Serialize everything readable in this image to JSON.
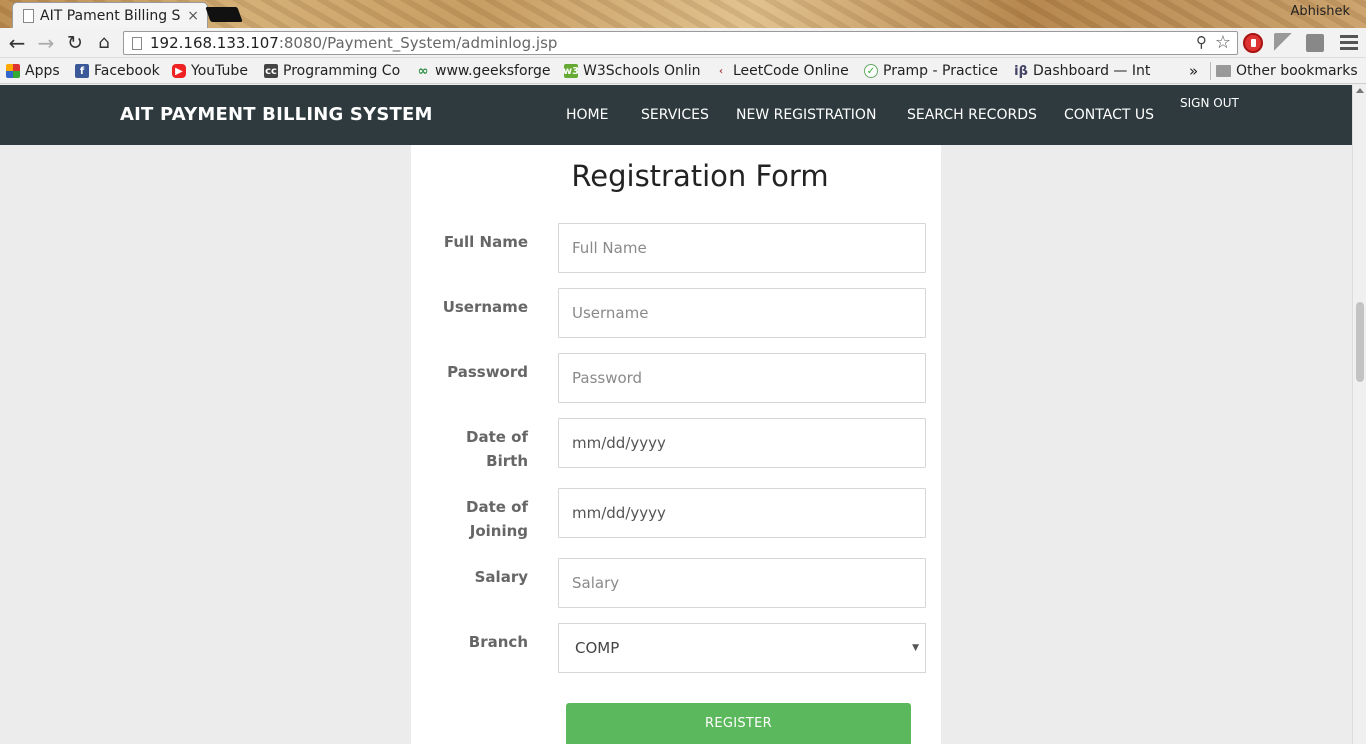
{
  "browser": {
    "tab_title": "AIT Pament Billing S",
    "tab_close": "×",
    "profile_name": "Abhishek",
    "url_host": "192.168.133.107",
    "url_path": ":8080/Payment_System/adminlog.jsp",
    "bookmarks": [
      {
        "label": "Apps",
        "icon": "apps-grid-icon"
      },
      {
        "label": "Facebook",
        "icon": "facebook-icon"
      },
      {
        "label": "YouTube",
        "icon": "youtube-icon"
      },
      {
        "label": "Programming Co",
        "icon": "codechef-icon"
      },
      {
        "label": "www.geeksforge",
        "icon": "geeksforgeeks-icon"
      },
      {
        "label": "W3Schools Onlin",
        "icon": "w3schools-icon"
      },
      {
        "label": "LeetCode Online",
        "icon": "leetcode-icon"
      },
      {
        "label": "Pramp - Practice",
        "icon": "pramp-icon"
      },
      {
        "label": "Dashboard — Int",
        "icon": "interviewbit-icon"
      }
    ],
    "more_bookmarks": "»",
    "other_bookmarks": "Other bookmarks"
  },
  "site": {
    "brand": "AIT PAYMENT BILLING SYSTEM",
    "nav": {
      "home": "HOME",
      "services": "SERVICES",
      "new_registration": "NEW REGISTRATION",
      "search_records": "SEARCH RECORDS",
      "contact_us": "CONTACT US",
      "sign_out": "SIGN OUT"
    },
    "colors": {
      "navbar": "#2f3a3e",
      "register_button": "#5cb85c",
      "page_background": "#ececec"
    }
  },
  "form": {
    "title": "Registration Form",
    "fields": {
      "full_name": {
        "label": "Full Name",
        "placeholder": "Full Name"
      },
      "username": {
        "label": "Username",
        "placeholder": "Username"
      },
      "password": {
        "label": "Password",
        "placeholder": "Password"
      },
      "dob": {
        "label_line1": "Date of",
        "label_line2": "Birth",
        "value": "mm/dd/yyyy"
      },
      "doj": {
        "label_line1": "Date of",
        "label_line2": "Joining",
        "value": "mm/dd/yyyy"
      },
      "salary": {
        "label": "Salary",
        "placeholder": "Salary"
      },
      "branch": {
        "label": "Branch",
        "selected": "COMP"
      }
    },
    "submit_label": "REGISTER"
  }
}
